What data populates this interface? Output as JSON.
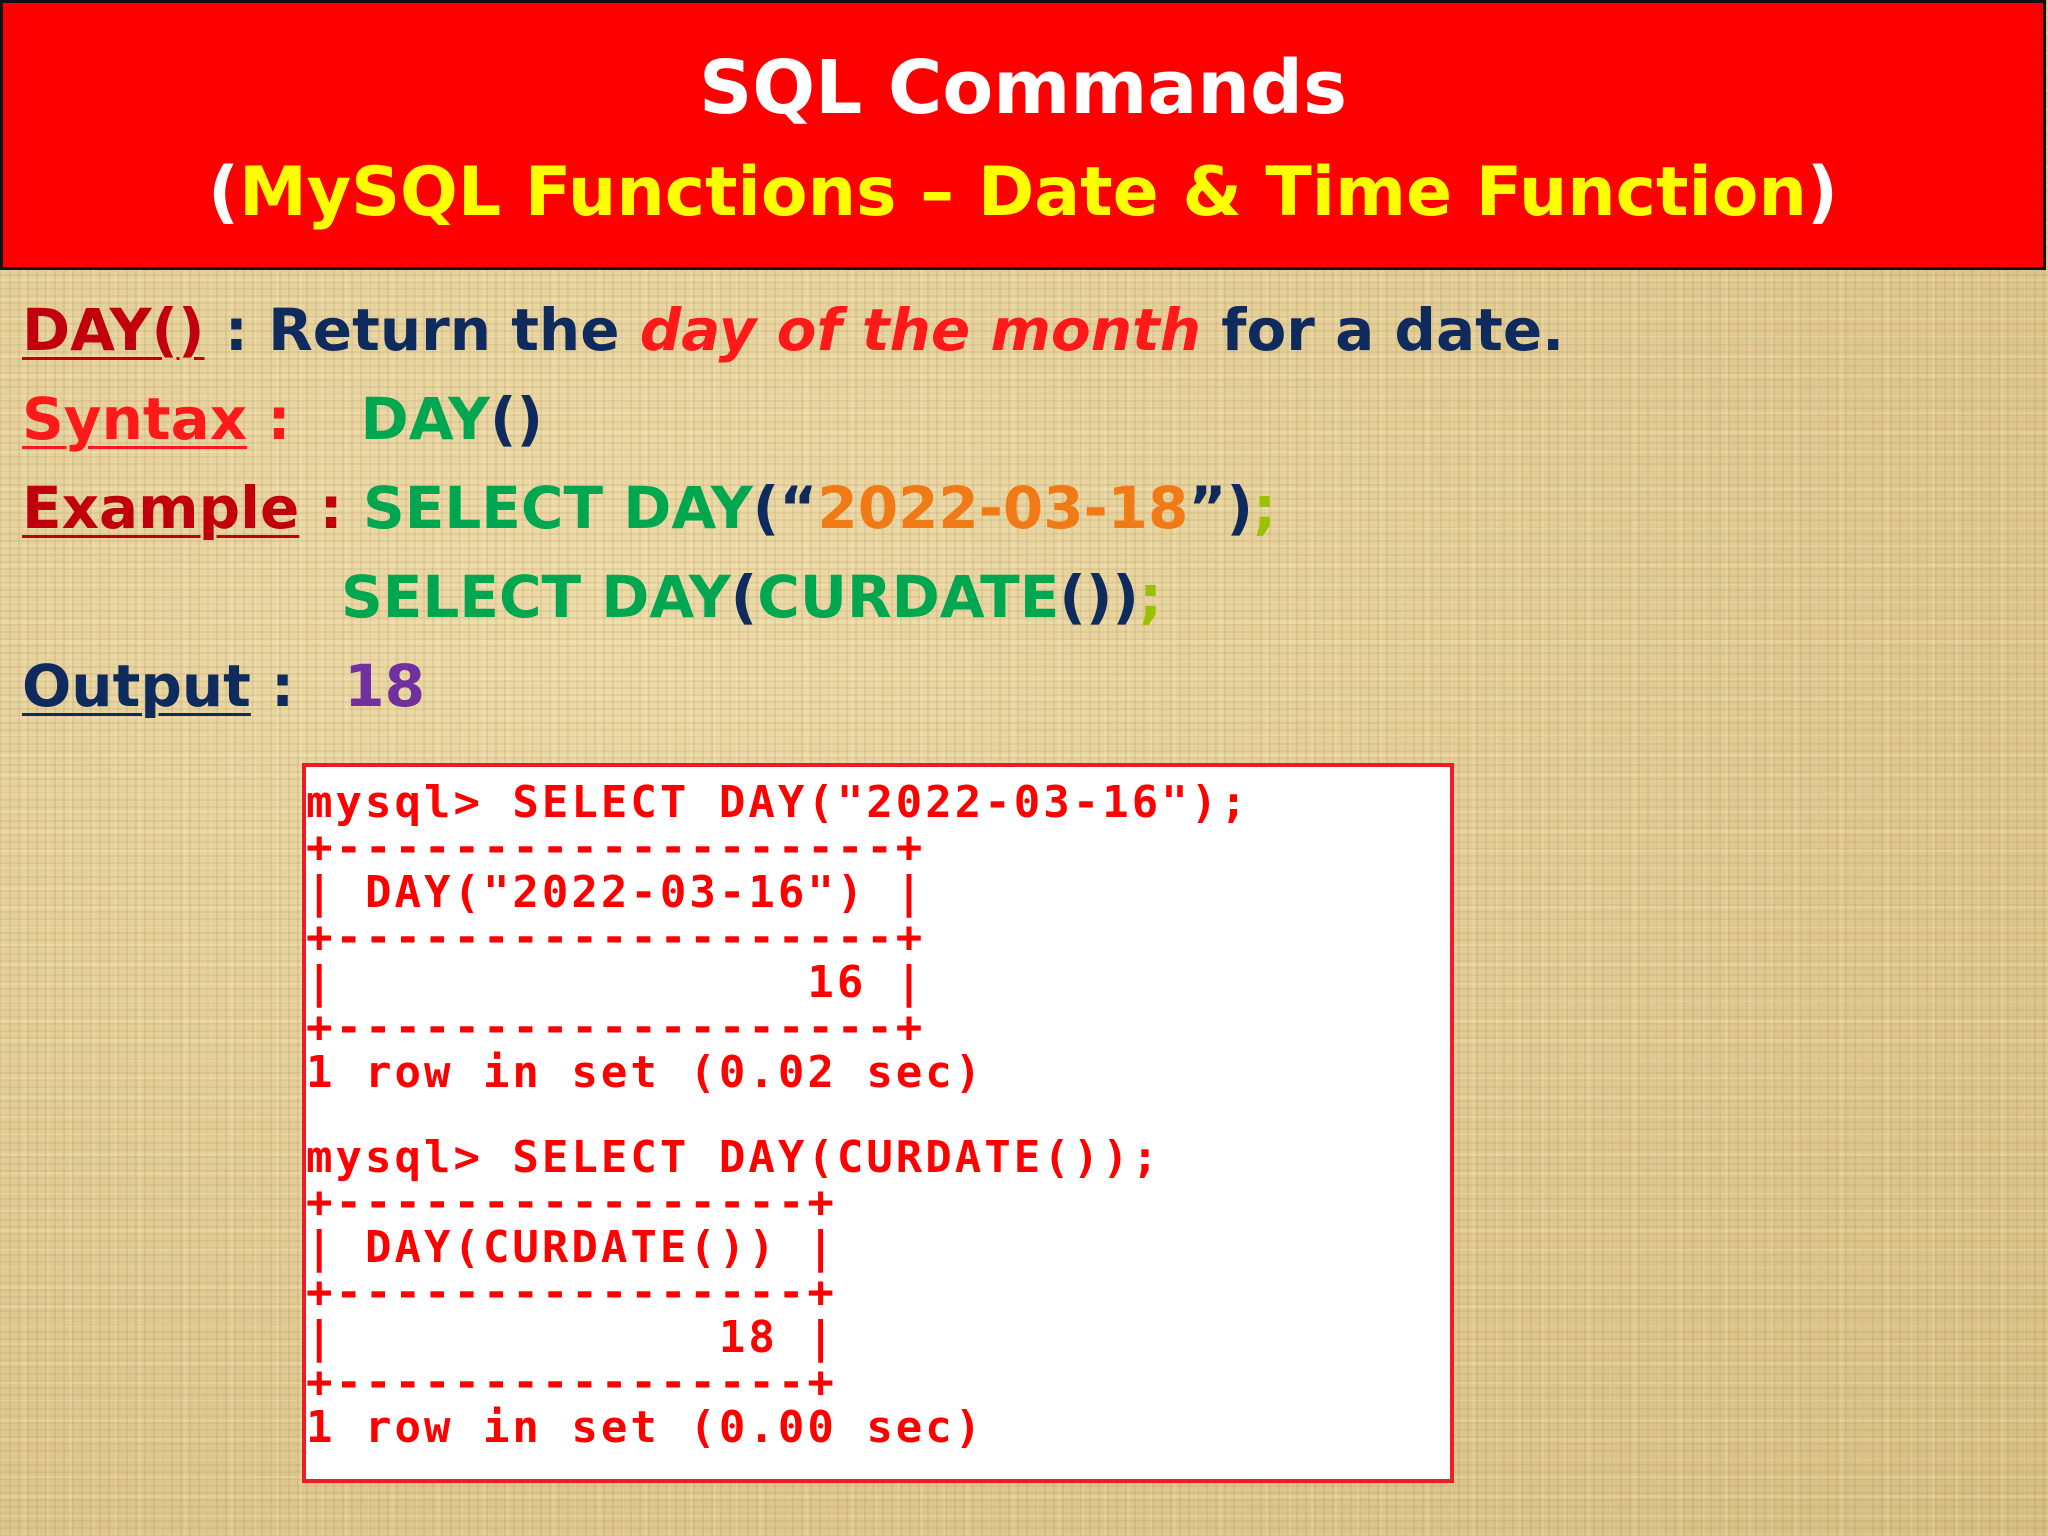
{
  "header": {
    "title": "SQL Commands",
    "subtitle_open": "(",
    "subtitle_text": "MySQL Functions – Date & Time Function",
    "subtitle_close": ")"
  },
  "definition": {
    "function_name": "DAY()",
    "separator": " : ",
    "text_before": "Return the ",
    "emphasis": "day of the month",
    "text_after": " for a date."
  },
  "syntax": {
    "label": "Syntax",
    "separator": " :",
    "func": "DAY",
    "parens": "()"
  },
  "example": {
    "label": "Example",
    "separator": " : ",
    "line1_func": "SELECT DAY",
    "line1_open": "(“",
    "line1_arg": "2022-03-18",
    "line1_close": "”)",
    "line1_semi": ";",
    "line2_func": "SELECT DAY",
    "line2_open": "(",
    "line2_arg": "CURDATE",
    "line2_close": "())",
    "line2_semi": ";"
  },
  "output": {
    "label": "Output",
    "separator": " :",
    "value": "18"
  },
  "console": {
    "lines": [
      "mysql> SELECT DAY(\"2022-03-16\");",
      "+-------------------+",
      "| DAY(\"2022-03-16\") |",
      "+-------------------+",
      "|                16 |",
      "+-------------------+",
      "1 row in set (0.02 sec)",
      "",
      "mysql> SELECT DAY(CURDATE());",
      "+----------------+",
      "| DAY(CURDATE()) |",
      "+----------------+",
      "|             18 |",
      "+----------------+",
      "1 row in set (0.00 sec)"
    ]
  },
  "colors": {
    "title_bar": "#ff0000",
    "title_text": "#ffffff",
    "subtitle_text": "#ffff00",
    "label_dark_red": "#c0000c",
    "body_navy": "#0f2a5c",
    "code_green": "#00a650",
    "string_orange": "#f07b16",
    "output_purple": "#7030a0",
    "console_text": "#ff0000"
  }
}
